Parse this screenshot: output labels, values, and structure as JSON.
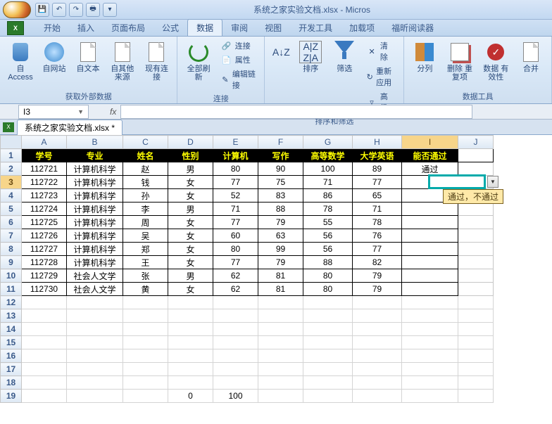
{
  "window": {
    "title": "系统之家实验文档.xlsx - Micros"
  },
  "tabs": [
    "开始",
    "插入",
    "页面布局",
    "公式",
    "数据",
    "审阅",
    "视图",
    "开发工具",
    "加载项",
    "福昕阅读器"
  ],
  "active_tab_index": 4,
  "ribbon": {
    "ext_data": {
      "access": "自 Access",
      "web": "自网站",
      "text": "自文本",
      "other": "自其他来源",
      "existing": "现有连接",
      "label": "获取外部数据"
    },
    "connections": {
      "refresh": "全部刷新",
      "conn": "连接",
      "prop": "属性",
      "editlink": "编辑链接",
      "label": "连接"
    },
    "sortfilter": {
      "sort": "排序",
      "filter": "筛选",
      "clear": "清除",
      "reapply": "重新应用",
      "adv": "高级",
      "label": "排序和筛选"
    },
    "datatools": {
      "split": "分列",
      "dup": "删除\n重复项",
      "valid": "数据\n有效性",
      "consol": "合并",
      "label": "数据工具"
    }
  },
  "namebox": "I3",
  "fx": "fx",
  "workbook_tab": "系统之家实验文档.xlsx *",
  "columns": [
    "A",
    "B",
    "C",
    "D",
    "E",
    "F",
    "G",
    "H",
    "I",
    "J"
  ],
  "headers": [
    "学号",
    "专业",
    "姓名",
    "性别",
    "计算机",
    "写作",
    "高等数学",
    "大学英语",
    "能否通过"
  ],
  "rows": [
    [
      "112721",
      "计算机科学",
      "赵",
      "男",
      "80",
      "90",
      "100",
      "89",
      "通过"
    ],
    [
      "112722",
      "计算机科学",
      "钱",
      "女",
      "77",
      "75",
      "71",
      "77",
      ""
    ],
    [
      "112723",
      "计算机科学",
      "孙",
      "女",
      "52",
      "83",
      "86",
      "65",
      ""
    ],
    [
      "112724",
      "计算机科学",
      "李",
      "男",
      "71",
      "88",
      "78",
      "71",
      ""
    ],
    [
      "112725",
      "计算机科学",
      "周",
      "女",
      "77",
      "79",
      "55",
      "78",
      ""
    ],
    [
      "112726",
      "计算机科学",
      "吴",
      "女",
      "60",
      "63",
      "56",
      "76",
      ""
    ],
    [
      "112727",
      "计算机科学",
      "郑",
      "女",
      "80",
      "99",
      "56",
      "77",
      ""
    ],
    [
      "112728",
      "计算机科学",
      "王",
      "女",
      "77",
      "79",
      "88",
      "82",
      ""
    ],
    [
      "112729",
      "社会人文学",
      "张",
      "男",
      "62",
      "81",
      "80",
      "79",
      ""
    ],
    [
      "112730",
      "社会人文学",
      "黄",
      "女",
      "62",
      "81",
      "80",
      "79",
      ""
    ]
  ],
  "row19": {
    "D": "0",
    "E": "100"
  },
  "dropdown_options": "通过，不通过",
  "selected_cell": "I3"
}
